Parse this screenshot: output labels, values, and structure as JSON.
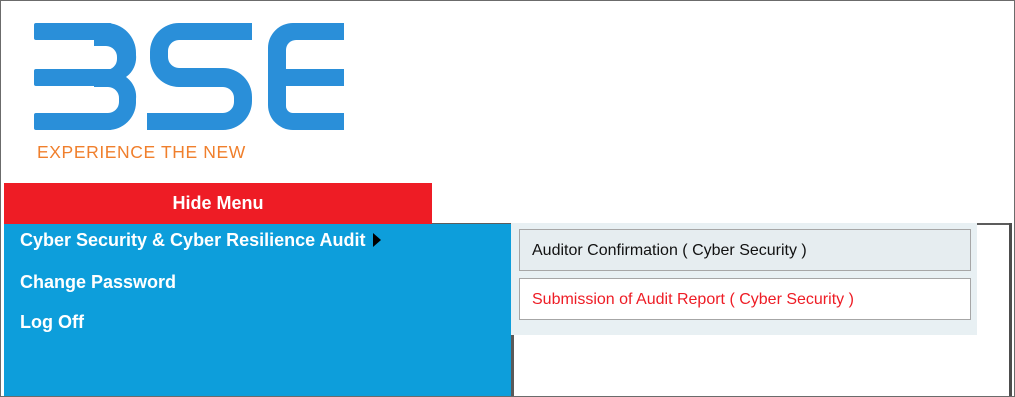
{
  "logo": {
    "brand": "BSE",
    "tagline": "EXPERIENCE THE NEW",
    "brand_color": "#2a8fd9",
    "tagline_color": "#f07f2c"
  },
  "hide_menu": {
    "label": "Hide Menu",
    "color": "#ee1c25"
  },
  "menu": {
    "color": "#0d9edb",
    "items": [
      {
        "label": "Cyber Security & Cyber Resilience Audit",
        "has_submenu": true
      },
      {
        "label": "Change Password",
        "has_submenu": false
      },
      {
        "label": "Log Off",
        "has_submenu": false
      }
    ]
  },
  "submenu": {
    "items": [
      {
        "label": "Auditor Confirmation ( Cyber Security )",
        "state": "normal"
      },
      {
        "label": "Submission of Audit Report ( Cyber Security )",
        "state": "highlighted",
        "color": "#ee1c25"
      }
    ]
  }
}
